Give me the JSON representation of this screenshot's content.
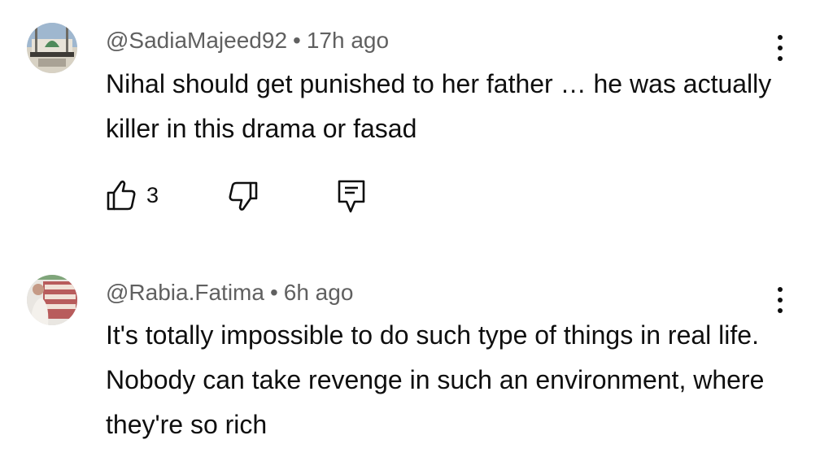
{
  "comments": [
    {
      "author": "@SadiaMajeed92",
      "separator": "•",
      "time": "17h ago",
      "text": "Nihal should get punished to her father … he was actually killer  in this drama or fasad",
      "likes": "3"
    },
    {
      "author": "@Rabia.Fatima",
      "separator": "•",
      "time": "6h ago",
      "text": "It's totally impossible to do such type of things in real life. Nobody can take revenge in such an environment, where they're so rich"
    }
  ],
  "icons": {
    "like": "thumbs-up-icon",
    "dislike": "thumbs-down-icon",
    "reply": "reply-comment-icon",
    "menu": "more-vertical-icon"
  },
  "colors": {
    "text": "#0f0f0f",
    "meta": "#606060",
    "background": "#ffffff"
  }
}
